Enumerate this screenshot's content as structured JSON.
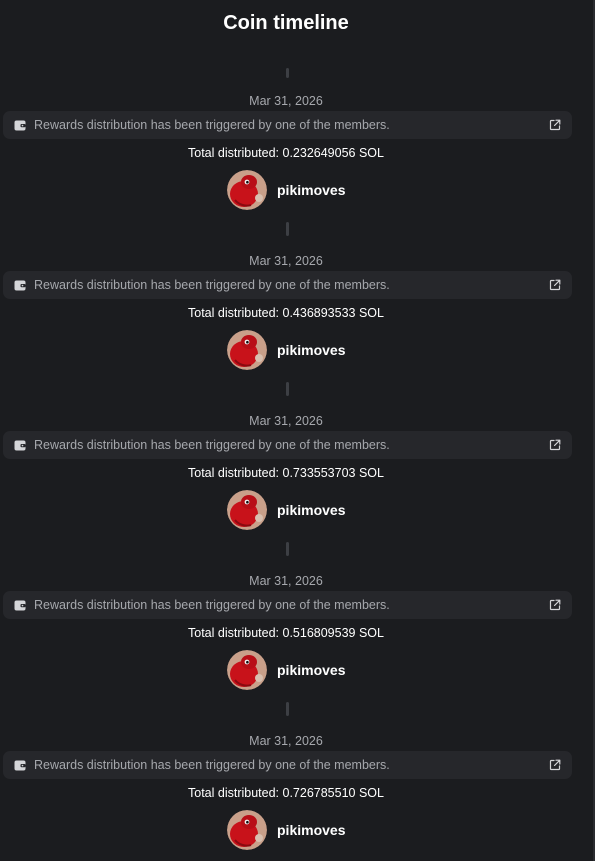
{
  "header": {
    "title": "Coin timeline"
  },
  "entries": [
    {
      "date": "Mar 31, 2026",
      "message": "Rewards distribution has been triggered by one of the members.",
      "total": "Total distributed: 0.232649056 SOL",
      "username": "pikimoves"
    },
    {
      "date": "Mar 31, 2026",
      "message": "Rewards distribution has been triggered by one of the members.",
      "total": "Total distributed: 0.436893533 SOL",
      "username": "pikimoves"
    },
    {
      "date": "Mar 31, 2026",
      "message": "Rewards distribution has been triggered by one of the members.",
      "total": "Total distributed: 0.733553703 SOL",
      "username": "pikimoves"
    },
    {
      "date": "Mar 31, 2026",
      "message": "Rewards distribution has been triggered by one of the members.",
      "total": "Total distributed: 0.516809539 SOL",
      "username": "pikimoves"
    },
    {
      "date": "Mar 31, 2026",
      "message": "Rewards distribution has been triggered by one of the members.",
      "total": "Total distributed: 0.726785510 SOL",
      "username": "pikimoves"
    }
  ],
  "icons": {
    "banner": "wallet-icon",
    "link": "external-link-icon",
    "user": "avatar"
  },
  "colors": {
    "background": "#1b1c1f",
    "banner": "#26272b",
    "muted_text": "#a6a8ad",
    "avatar_red": "#c8121a"
  }
}
